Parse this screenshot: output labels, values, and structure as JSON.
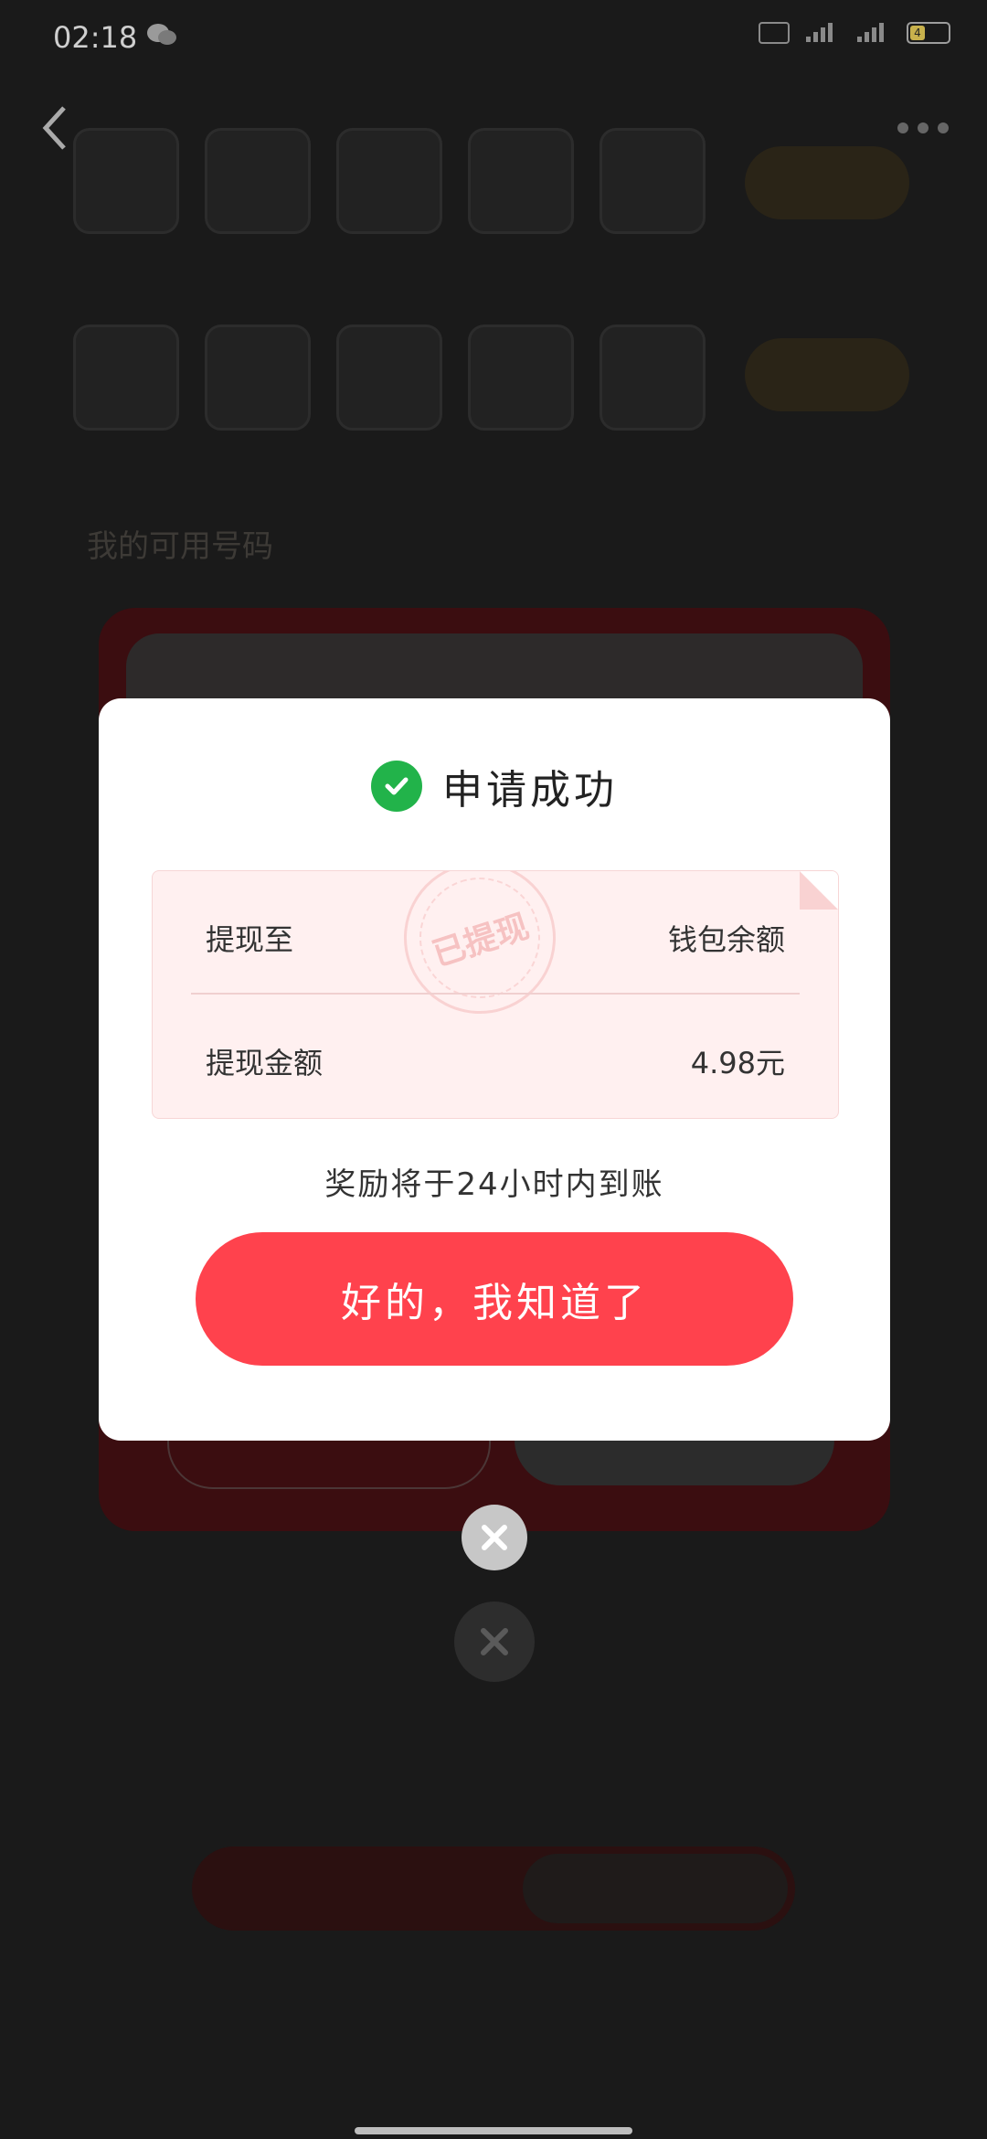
{
  "status_bar": {
    "time": "02:18",
    "battery": "4"
  },
  "background": {
    "section_label": "我的可用号码"
  },
  "dialog": {
    "title": "申请成功",
    "stamp": "已提现",
    "withdraw_to_label": "提现至",
    "withdraw_to_value": "钱包余额",
    "amount_label": "提现金额",
    "amount_value": "4.98元",
    "notice": "奖励将于24小时内到账",
    "ok_button": "好的，我知道了"
  },
  "colors": {
    "accent": "#ff424d",
    "success": "#22b34a"
  }
}
